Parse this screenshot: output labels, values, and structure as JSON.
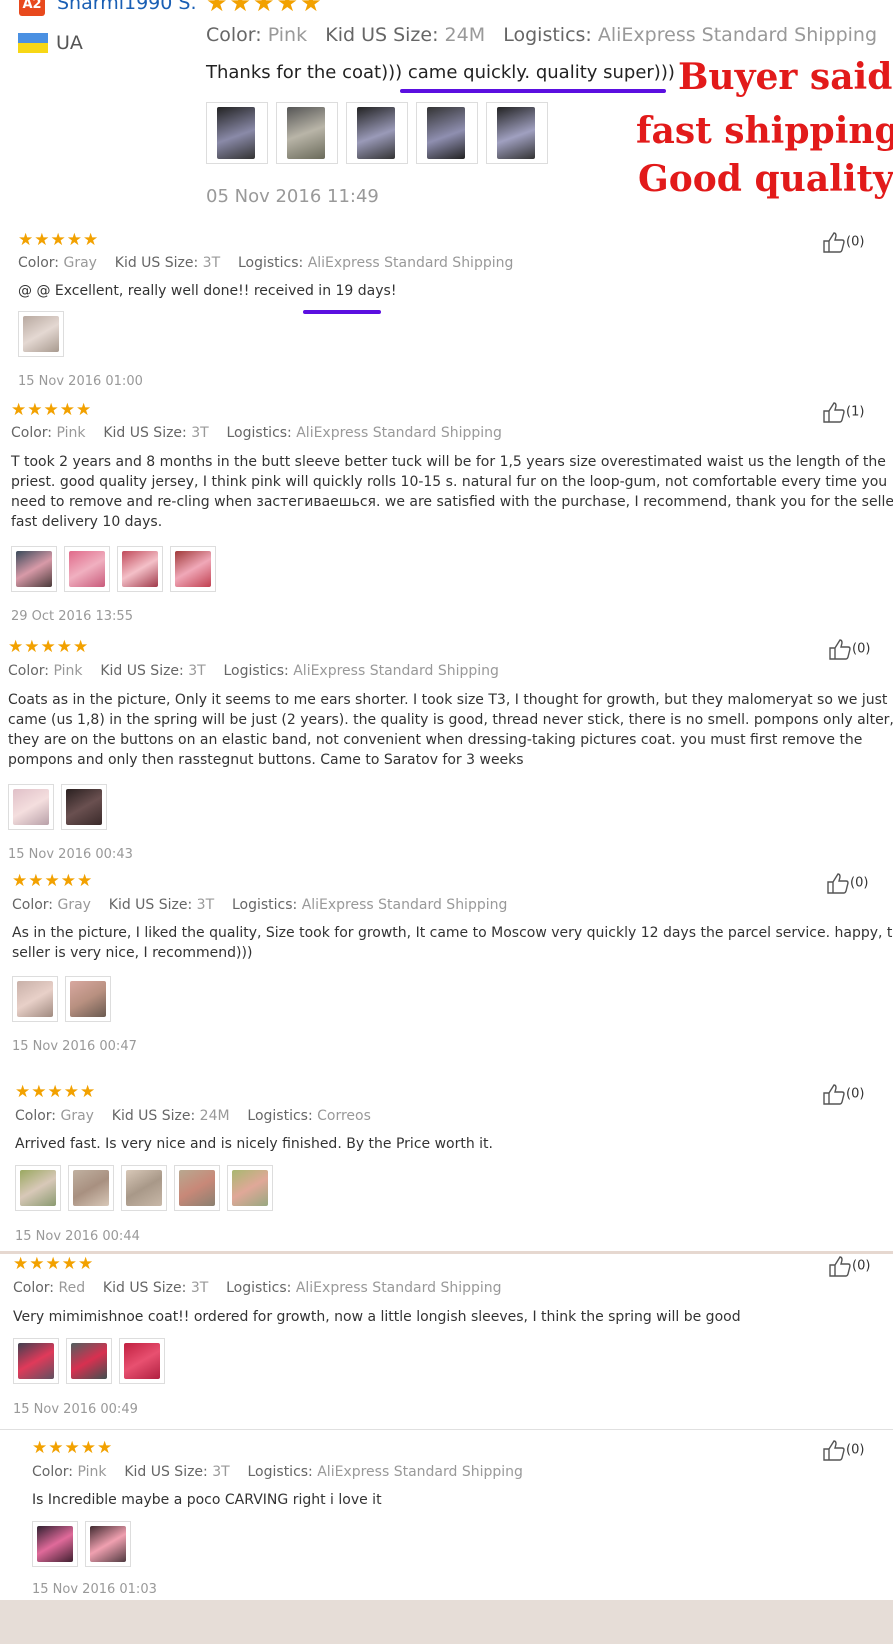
{
  "header": {
    "badge": "A2",
    "username": "Sharmi1990 S.",
    "country": "UA",
    "stars": "★★★★★",
    "color_label": "Color:",
    "color": "Pink",
    "size_label": "Kid US Size:",
    "size": "24M",
    "log_label": "Logistics:",
    "logistics": "AliExpress Standard Shipping",
    "text": "Thanks for the coat))) came quickly. quality super)))",
    "date": "05 Nov 2016 11:49",
    "annotation": [
      "Buyer said",
      "fast shipping",
      "Good quality"
    ]
  },
  "reviews": [
    {
      "stars": "★★★★★",
      "color_label": "Color:",
      "color": "Gray",
      "size_label": "Kid US Size:",
      "size": "3T",
      "log_label": "Logistics:",
      "logistics": "AliExpress Standard Shipping",
      "text": "@ @ Excellent, really well done!! received in 19 days!",
      "date": "15 Nov 2016 01:00",
      "likes": "(0)"
    },
    {
      "stars": "★★★★★",
      "color_label": "Color:",
      "color": "Pink",
      "size_label": "Kid US Size:",
      "size": "3T",
      "log_label": "Logistics:",
      "logistics": "AliExpress Standard Shipping",
      "text": [
        "T took 2 years and 8 months in the butt sleeve better tuck will be for 1,5 years size overestimated waist us the length of the",
        "priest. good quality jersey, I think pink will quickly rolls 10-15 s. natural fur on the loop-gum, not comfortable every time you",
        "need to remove and re-cling when застегиваешься. we are satisfied with the purchase, I recommend, thank you for the seller",
        "fast delivery 10 days."
      ],
      "date": "29 Oct 2016 13:55",
      "likes": "(1)"
    },
    {
      "stars": "★★★★★",
      "color_label": "Color:",
      "color": "Pink",
      "size_label": "Kid US Size:",
      "size": "3T",
      "log_label": "Logistics:",
      "logistics": "AliExpress Standard Shipping",
      "text": [
        "Coats as in the picture, Only it seems to me ears shorter. I took size T3, I thought for growth, but they malomeryat so we just",
        "came (us 1,8) in the spring will be just (2 years). the quality is good, thread never stick, there is no smell. pompons only alter,",
        "they are on the buttons on an elastic band, not convenient when dressing-taking pictures coat. you must first remove the",
        "pompons and only then rasstegnut buttons. Came to Saratov for 3 weeks"
      ],
      "date": "15 Nov 2016 00:43",
      "likes": "(0)"
    },
    {
      "stars": "★★★★★",
      "color_label": "Color:",
      "color": "Gray",
      "size_label": "Kid US Size:",
      "size": "3T",
      "log_label": "Logistics:",
      "logistics": "AliExpress Standard Shipping",
      "text": [
        "As in the picture, I liked the quality, Size took for growth, It came to Moscow very quickly 12 days the parcel service. happy, the",
        "seller is very nice, I recommend)))"
      ],
      "date": "15 Nov 2016 00:47",
      "likes": "(0)"
    },
    {
      "stars": "★★★★★",
      "color_label": "Color:",
      "color": "Gray",
      "size_label": "Kid US Size:",
      "size": "24M",
      "log_label": "Logistics:",
      "logistics": "Correos",
      "text": "Arrived fast. Is very nice and is nicely finished. By the Price worth it.",
      "date": "15 Nov 2016 00:44",
      "likes": "(0)"
    },
    {
      "stars": "★★★★★",
      "color_label": "Color:",
      "color": "Red",
      "size_label": "Kid US Size:",
      "size": "3T",
      "log_label": "Logistics:",
      "logistics": "AliExpress Standard Shipping",
      "text": "Very mimimishnoe coat!! ordered for growth, now a little longish sleeves, I think the spring will be good",
      "date": "15 Nov 2016 00:49",
      "likes": "(0)"
    },
    {
      "stars": "★★★★★",
      "color_label": "Color:",
      "color": "Pink",
      "size_label": "Kid US Size:",
      "size": "3T",
      "log_label": "Logistics:",
      "logistics": "AliExpress Standard Shipping",
      "text": "Is Incredible maybe a poco CARVING right i love it",
      "date": "15 Nov 2016 01:03",
      "likes": "(0)"
    }
  ],
  "colors": {
    "accent_red": "#e21a1a",
    "underline": "#5b0fe0",
    "star": "#f2a100"
  }
}
